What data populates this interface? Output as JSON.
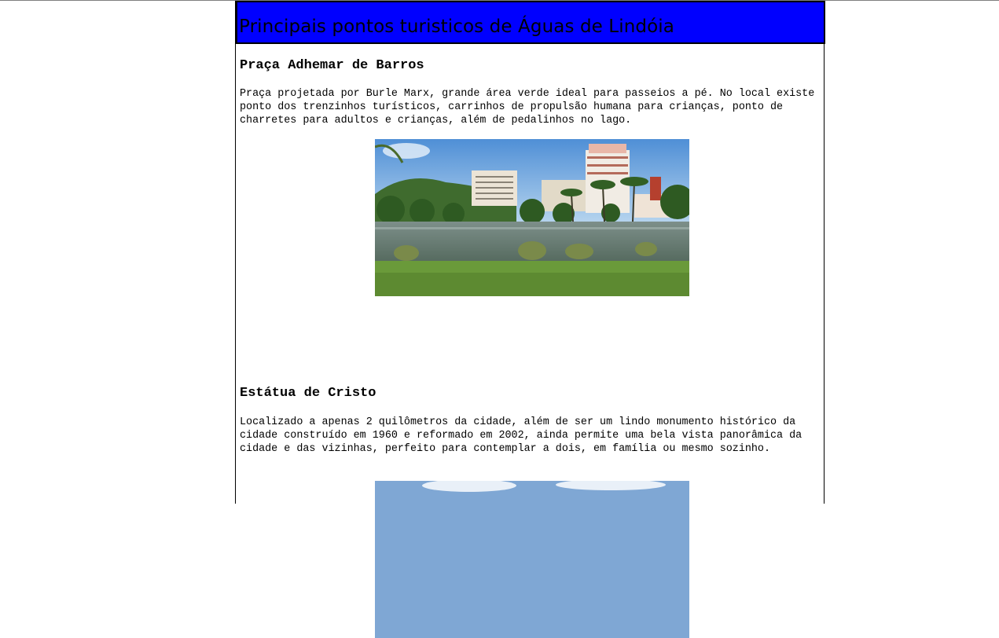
{
  "page": {
    "title": "Principais pontos turisticos de Águas de Lindóia"
  },
  "sections": [
    {
      "title": "Praça Adhemar de Barros",
      "text": "Praça projetada por Burle Marx, grande área verde ideal para passeios a pé. No local existe ponto dos trenzinhos turísticos, carrinhos de propulsão humana para crianças, ponto de charretes para adultos e crianças, além de pedalinhos no lago."
    },
    {
      "title": "Estátua de Cristo",
      "text": "Localizado a apenas 2 quilômetros da cidade, além de ser um lindo monumento histórico da cidade construído em 1960 e reformado em 2002, ainda permite uma bela vista panorâmica da cidade e das vizinhas, perfeito para contemplar a dois, em família ou mesmo sozinho."
    }
  ],
  "colors": {
    "banner": "#0000ff",
    "border": "#000000"
  }
}
